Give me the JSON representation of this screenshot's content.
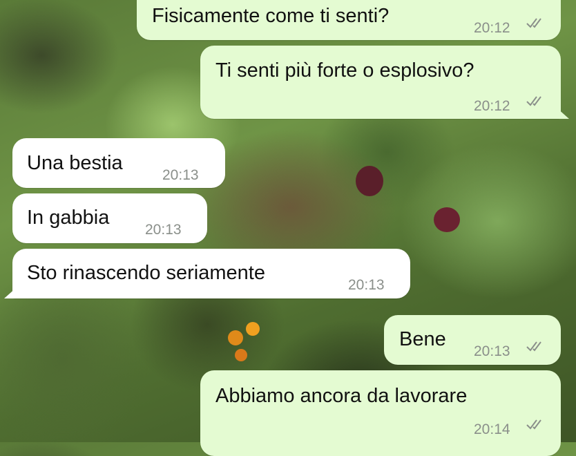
{
  "messages": [
    {
      "direction": "outgoing",
      "text": "Fisicamente come ti senti?",
      "time": "20:12",
      "status": "read-double-check-icon"
    },
    {
      "direction": "outgoing",
      "text": "Ti senti più forte o esplosivo?",
      "time": "20:12",
      "status": "read-double-check-icon"
    },
    {
      "direction": "incoming",
      "text": "Una bestia",
      "time": "20:13"
    },
    {
      "direction": "incoming",
      "text": "In gabbia",
      "time": "20:13"
    },
    {
      "direction": "incoming",
      "text": "Sto rinascendo seriamente",
      "time": "20:13"
    },
    {
      "direction": "outgoing",
      "text": "Bene",
      "time": "20:13",
      "status": "read-double-check-icon"
    },
    {
      "direction": "outgoing",
      "text": "Abbiamo ancora da lavorare",
      "time": "20:14",
      "status": "read-double-check-icon"
    }
  ],
  "colors": {
    "outgoing_bubble": "#e4fbd2",
    "incoming_bubble": "#ffffff",
    "timestamp": "#8a8f8a",
    "wallpaper": "garden-photo"
  }
}
